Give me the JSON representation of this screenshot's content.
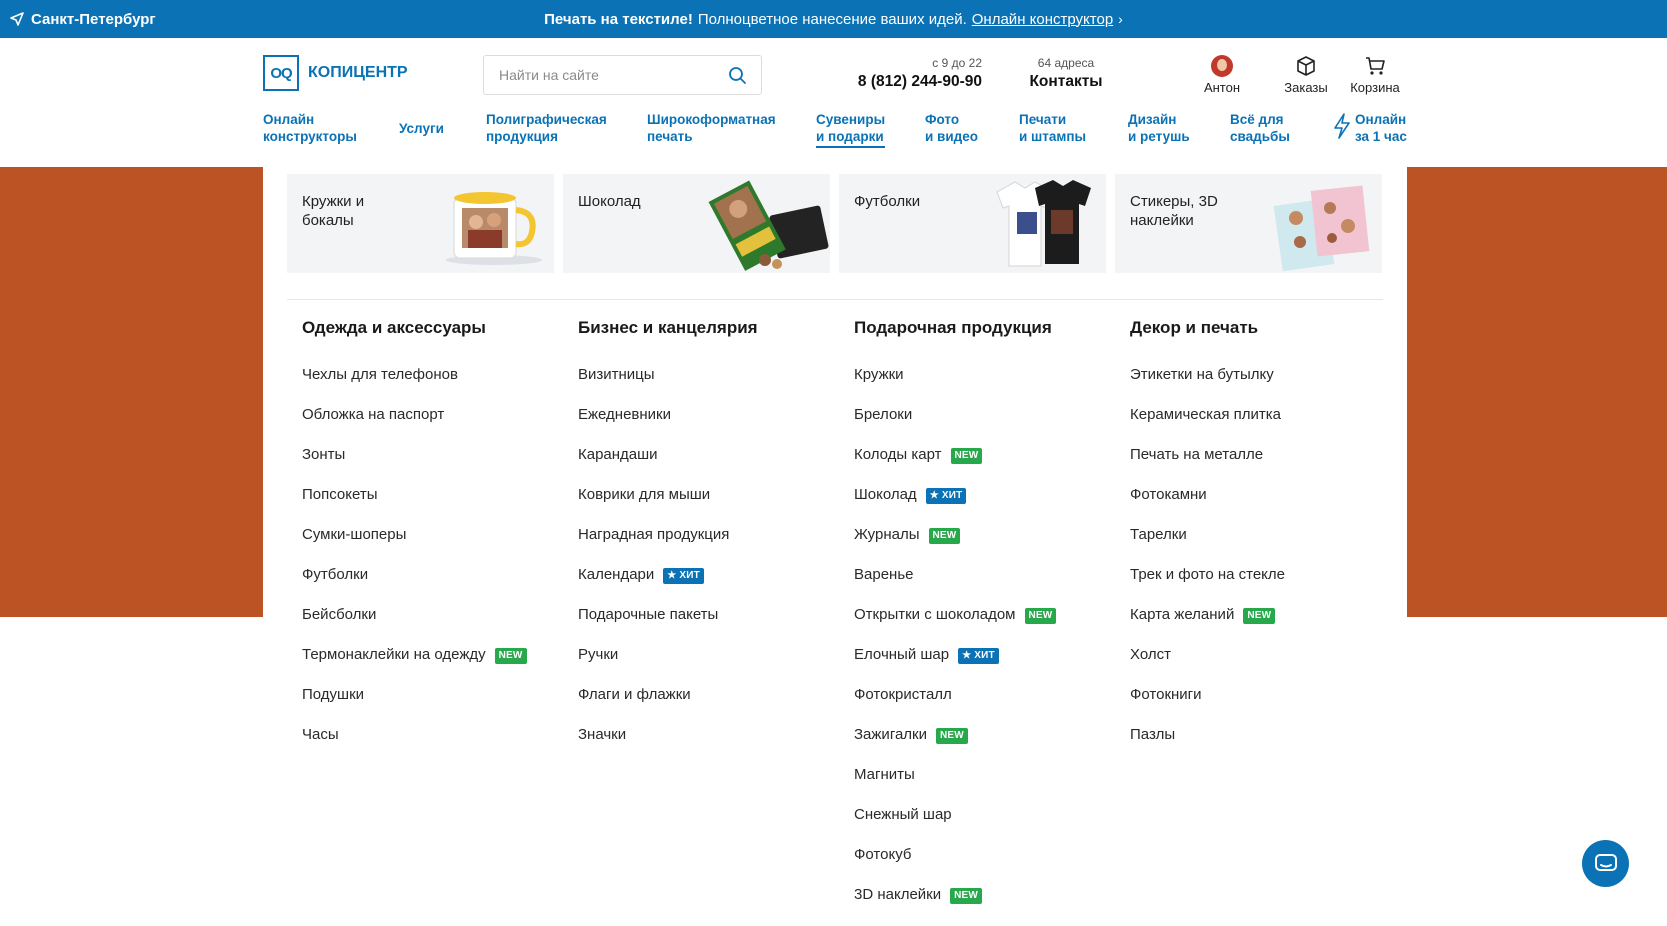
{
  "topbar": {
    "city": "Санкт-Петербург",
    "promo_bold": "Печать на текстиле!",
    "promo_text": "Полноцветное нанесение ваших идей.",
    "promo_link": "Онлайн конструктор",
    "promo_chevron": "›"
  },
  "header": {
    "logo_mark": "OQ",
    "logo_text": "КОПИЦЕНТР",
    "search_placeholder": "Найти на сайте",
    "hours": "с 9 до 22",
    "phone": "8 (812) 244-90-90",
    "addresses": "64 адреса",
    "contacts": "Контакты",
    "user_name": "Антон",
    "orders": "Заказы",
    "cart": "Корзина"
  },
  "nav": [
    {
      "line1": "Онлайн",
      "line2": "конструкторы"
    },
    {
      "line1": "Услуги",
      "line2": ""
    },
    {
      "line1": "Полиграфическая",
      "line2": "продукция"
    },
    {
      "line1": "Широкоформатная",
      "line2": "печать"
    },
    {
      "line1": "Сувениры",
      "line2": "и подарки"
    },
    {
      "line1": "Фото",
      "line2": "и видео"
    },
    {
      "line1": "Печати",
      "line2": "и штампы"
    },
    {
      "line1": "Дизайн",
      "line2": "и ретушь"
    },
    {
      "line1": "Всё для",
      "line2": "свадьбы"
    },
    {
      "line1": "Онлайн",
      "line2": "за 1 час"
    }
  ],
  "cards": [
    {
      "line1": "Кружки и",
      "line2": "бокалы"
    },
    {
      "line1": "Шоколад",
      "line2": ""
    },
    {
      "line1": "Футболки",
      "line2": ""
    },
    {
      "line1": "Стикеры, 3D",
      "line2": "наклейки"
    }
  ],
  "columns": [
    {
      "title": "Одежда и аксессуары",
      "items": [
        {
          "label": "Чехлы для телефонов",
          "badge": ""
        },
        {
          "label": "Обложка на паспорт",
          "badge": ""
        },
        {
          "label": "Зонты",
          "badge": ""
        },
        {
          "label": "Попсокеты",
          "badge": ""
        },
        {
          "label": "Сумки-шоперы",
          "badge": ""
        },
        {
          "label": "Футболки",
          "badge": ""
        },
        {
          "label": "Бейсболки",
          "badge": ""
        },
        {
          "label": "Термонаклейки на одежду",
          "badge": "NEW"
        },
        {
          "label": "Подушки",
          "badge": ""
        },
        {
          "label": "Часы",
          "badge": ""
        }
      ]
    },
    {
      "title": "Бизнес и канцелярия",
      "items": [
        {
          "label": "Визитницы",
          "badge": ""
        },
        {
          "label": "Ежедневники",
          "badge": ""
        },
        {
          "label": "Карандаши",
          "badge": ""
        },
        {
          "label": "Коврики для мыши",
          "badge": ""
        },
        {
          "label": "Наградная продукция",
          "badge": ""
        },
        {
          "label": "Календари",
          "badge": "★ ХИТ"
        },
        {
          "label": "Подарочные пакеты",
          "badge": ""
        },
        {
          "label": "Ручки",
          "badge": ""
        },
        {
          "label": "Флаги и флажки",
          "badge": ""
        },
        {
          "label": "Значки",
          "badge": ""
        }
      ]
    },
    {
      "title": "Подарочная продукция",
      "items": [
        {
          "label": "Кружки",
          "badge": ""
        },
        {
          "label": "Брелоки",
          "badge": ""
        },
        {
          "label": "Колоды карт",
          "badge": "NEW"
        },
        {
          "label": "Шоколад",
          "badge": "★ ХИТ"
        },
        {
          "label": "Журналы",
          "badge": "NEW"
        },
        {
          "label": "Варенье",
          "badge": ""
        },
        {
          "label": "Открытки с шоколадом",
          "badge": "NEW"
        },
        {
          "label": "Елочный шар",
          "badge": "★ ХИТ"
        },
        {
          "label": "Фотокристалл",
          "badge": ""
        },
        {
          "label": "Зажигалки",
          "badge": "NEW"
        },
        {
          "label": "Магниты",
          "badge": ""
        },
        {
          "label": "Снежный шар",
          "badge": ""
        },
        {
          "label": "Фотокуб",
          "badge": ""
        },
        {
          "label": "3D наклейки",
          "badge": "NEW"
        }
      ]
    },
    {
      "title": "Декор и печать",
      "items": [
        {
          "label": "Этикетки на бутылку",
          "badge": ""
        },
        {
          "label": "Керамическая плитка",
          "badge": ""
        },
        {
          "label": "Печать на металле",
          "badge": ""
        },
        {
          "label": "Фотокамни",
          "badge": ""
        },
        {
          "label": "Тарелки",
          "badge": ""
        },
        {
          "label": "Трек и фото на стекле",
          "badge": ""
        },
        {
          "label": "Карта желаний",
          "badge": "NEW"
        },
        {
          "label": "Холст",
          "badge": ""
        },
        {
          "label": "Фотокниги",
          "badge": ""
        },
        {
          "label": "Пазлы",
          "badge": ""
        }
      ]
    }
  ],
  "colors": {
    "brand": "#0a72b5",
    "banner": "#bb5325",
    "new_badge": "#27a84a",
    "hit_badge": "#0a72b5"
  },
  "icons": [
    "location-arrow-icon",
    "search-icon",
    "box-icon",
    "cart-icon",
    "lightning-icon",
    "chat-icon"
  ]
}
